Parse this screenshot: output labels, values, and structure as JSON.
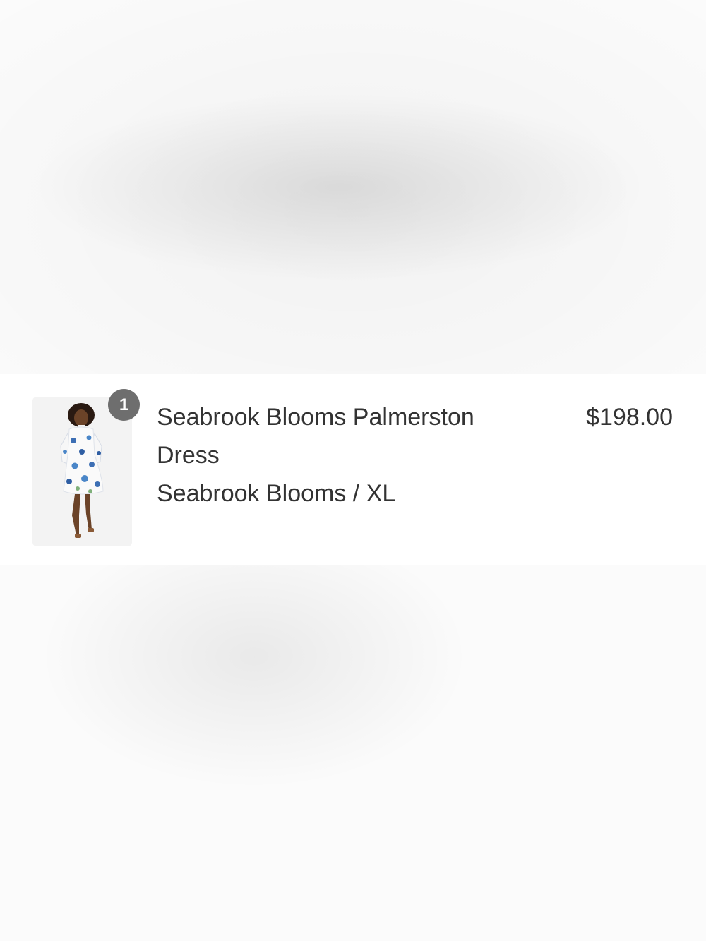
{
  "line_item": {
    "quantity": "1",
    "title": "Seabrook Blooms Palmerston Dress",
    "variant": "Seabrook Blooms / XL",
    "price": "$198.00",
    "thumbnail_icon": "dress-model-photo",
    "badge_color": "#6e6e6e",
    "text_color": "#333333"
  }
}
